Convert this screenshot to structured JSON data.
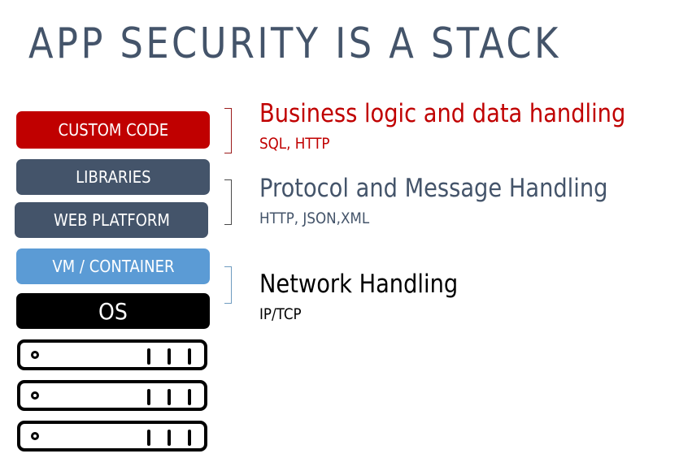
{
  "title": "APP SECURITY IS A STACK",
  "colors": {
    "title": "#44546a",
    "custom_code": "#c00000",
    "libraries": "#44546a",
    "web_platform": "#44546a",
    "vm_container": "#5b9bd5",
    "os": "#000000"
  },
  "stack": {
    "layers": [
      {
        "label": "CUSTOM CODE"
      },
      {
        "label": "LIBRARIES"
      },
      {
        "label": "WEB PLATFORM"
      },
      {
        "label": "VM / CONTAINER"
      },
      {
        "label": "OS"
      }
    ],
    "hardware": [
      {
        "icon": "server-icon"
      },
      {
        "icon": "server-icon"
      },
      {
        "icon": "server-icon"
      }
    ]
  },
  "groups": [
    {
      "heading": "Business logic and data handling",
      "detail": "SQL, HTTP"
    },
    {
      "heading": "Protocol and Message Handling",
      "detail": "HTTP, JSON,XML"
    },
    {
      "heading": "Network Handling",
      "detail": "IP/TCP"
    }
  ]
}
